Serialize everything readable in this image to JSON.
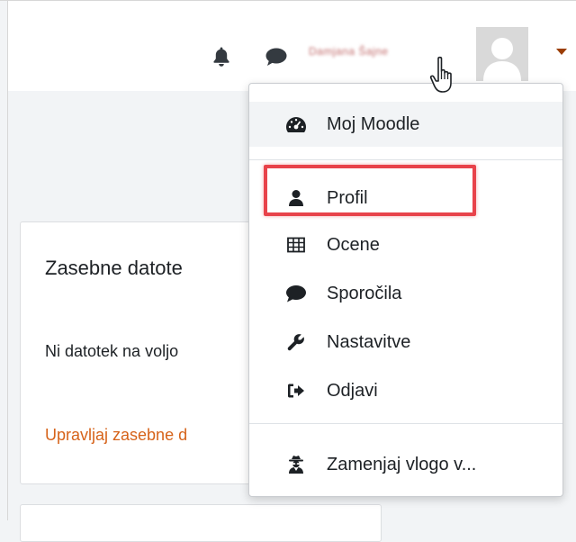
{
  "navbar": {
    "user_name": "Damjana Šajne",
    "icons": [
      "bell-icon",
      "chat-icon",
      "caret-down-icon"
    ]
  },
  "card": {
    "title": "Zasebne datote",
    "empty_text": "Ni datotek na voljo",
    "manage_link": "Upravljaj zasebne d"
  },
  "user_menu": {
    "items": [
      {
        "label": "Moj Moodle",
        "icon": "dashboard-icon"
      },
      {
        "label": "Profil",
        "icon": "user-icon"
      },
      {
        "label": "Ocene",
        "icon": "table-icon"
      },
      {
        "label": "Sporočila",
        "icon": "comment-icon"
      },
      {
        "label": "Nastavitve",
        "icon": "wrench-icon"
      },
      {
        "label": "Odjavi",
        "icon": "sign-out-icon"
      },
      {
        "label": "Zamenjaj vlogo v...",
        "icon": "user-secret-icon"
      }
    ]
  },
  "colors": {
    "accent": "#d6631a",
    "highlight": "#e8424a",
    "caret": "#9b3d05"
  }
}
